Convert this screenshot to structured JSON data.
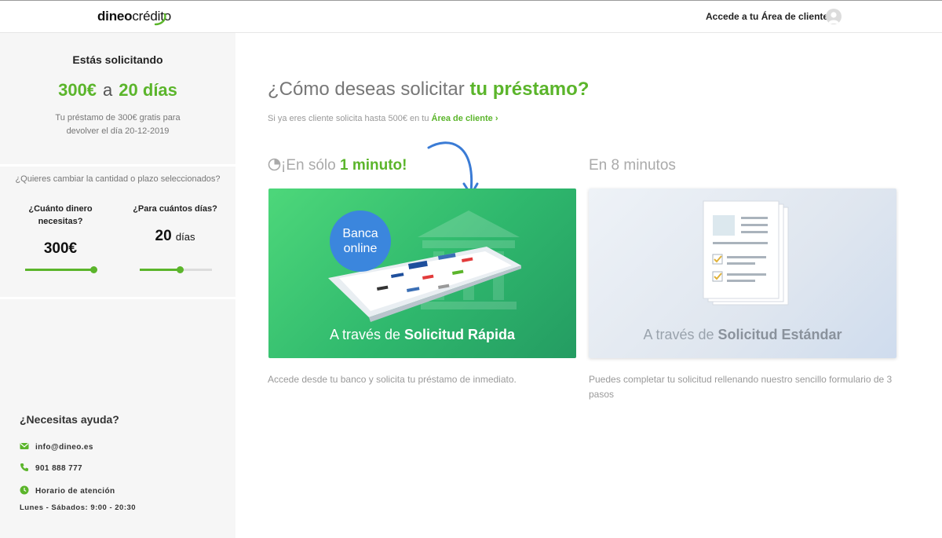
{
  "header": {
    "logo_bold": "dineo",
    "logo_light": "crédito",
    "account_link": "Accede a tu Área de cliente"
  },
  "sidebar": {
    "title": "Estás solicitando",
    "amount": "300€",
    "amount_sep": "a",
    "term": "20 días",
    "description": "Tu préstamo de 300€ gratis para devolver el día 20-12-2019",
    "change_question": "¿Quieres cambiar la cantidad o plazo seleccionados?",
    "amount_question": "¿Cuánto dinero necesitas?",
    "amount_value": "300€",
    "amount_slider_fraction": 0.95,
    "term_question": "¿Para cuántos días?",
    "term_value": "20",
    "term_unit": "días",
    "term_slider_fraction": 0.55,
    "help": {
      "title": "¿Necesitas ayuda?",
      "email": "info@dineo.es",
      "phone": "901 888 777",
      "hours_label": "Horario de atención",
      "hours": "Lunes - Sábados: 9:00 - 20:30"
    }
  },
  "main": {
    "title_prefix": "¿Cómo deseas solicitar",
    "title_highlight": "tu préstamo?",
    "sub_prefix": "Si ya eres cliente solicita hasta 500€ en tu",
    "sub_link": "Área de cliente",
    "fast": {
      "head_prefix": "¡En sólo",
      "head_highlight": "1 minuto!",
      "badge_line1": "Banca",
      "badge_line2": "online",
      "caption_prefix": "A través de",
      "caption_bold": "Solicitud Rápida",
      "description": "Accede desde tu banco y solicita tu préstamo de inmediato."
    },
    "standard": {
      "head": "En 8 minutos",
      "caption_prefix": "A través de",
      "caption_bold": "Solicitud Estándar",
      "description": "Puedes completar tu solicitud rellenando nuestro sencillo formulario de 3 pasos"
    }
  },
  "colors": {
    "accent_green": "#5bb52b",
    "badge_blue": "#3b86dd",
    "arrow_blue": "#3a7bd5"
  }
}
